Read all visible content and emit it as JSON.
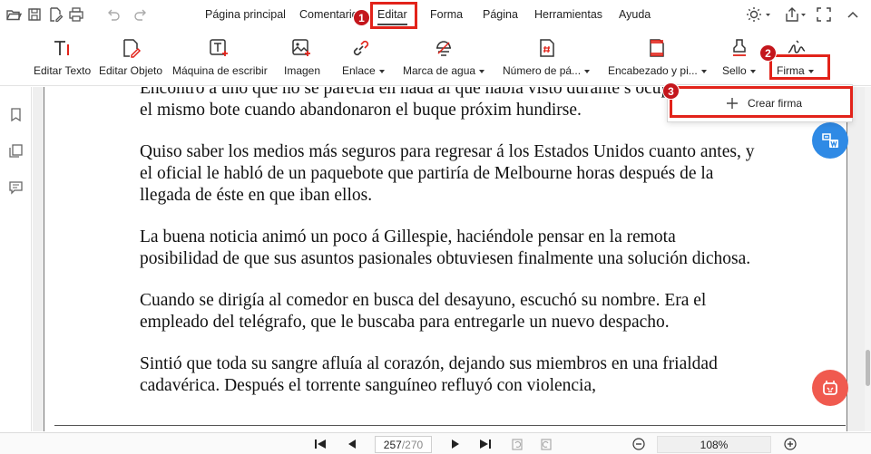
{
  "menu": {
    "items": [
      "Página principal",
      "Comentario",
      "Editar",
      "Forma",
      "Página",
      "Herramientas",
      "Ayuda"
    ]
  },
  "ribbon": {
    "edit_text": "Editar Texto",
    "edit_object": "Editar Objeto",
    "typewriter": "Máquina de escribir",
    "image": "Imagen",
    "link": "Enlace",
    "watermark": "Marca de agua",
    "page_number": "Número de pá...",
    "header_footer": "Encabezado y pi...",
    "stamp": "Sello",
    "signature": "Firma"
  },
  "dropdown": {
    "create_signature": "Crear firma"
  },
  "badges": [
    "1",
    "2",
    "3"
  ],
  "document": {
    "paragraphs": [
      "Encontró á uno que no se parecía en nada al que había visto durante s ocupando juntos el mismo bote cuando abandonaron el buque próxim hundirse.",
      "Quiso saber los medios más seguros para regresar á los Estados Unidos cuanto antes, y el oficial le habló de un paquebote que partiría de Melbourne horas después de la llegada de éste en que iban ellos.",
      "La buena noticia animó un poco á Gillespie, haciéndole pensar en la remota posibilidad de que sus asuntos pasionales obtuviesen finalmente una solución dichosa.",
      "Cuando se dirigía al comedor en busca del desayuno, escuchó su nombre. Era el empleado del telégrafo, que le buscaba para entregarle un nuevo despacho.",
      "Sintió que toda su sangre afluía al corazón, dejando sus miembros en una frialdad cadavérica. Después el torrente sanguíneo refluyó con violencia,"
    ]
  },
  "statusbar": {
    "current_page": "257",
    "total_pages": "/270",
    "zoom": "108%"
  },
  "colors": {
    "highlight": "#e2231a",
    "badge": "#c4161c",
    "translate_fab": "#2f8ae5",
    "assistant_fab": "#f05a4f"
  }
}
